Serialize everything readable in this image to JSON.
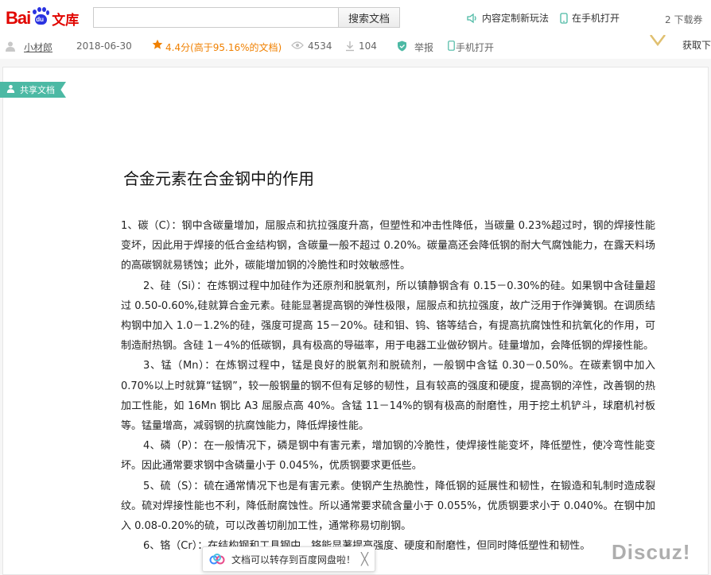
{
  "header": {
    "logo_bai": "Bai",
    "logo_du": "du",
    "logo_wenku": "文库",
    "search_placeholder": "",
    "search_button": "搜索文档",
    "custom_link": "内容定制新玩法",
    "mobile_link": "在手机打开",
    "downloads_text": "2 下载券",
    "get_link": "获取下"
  },
  "meta": {
    "user": "小材郎",
    "date": "2018-06-30",
    "rating": "4.4分(高于95.16%的文档)",
    "views": "4534",
    "downloads": "104",
    "report": "举报",
    "mobile": "手机打开"
  },
  "tag": "共享文档",
  "document": {
    "title": "合金元素在合金钢中的作用",
    "paragraphs": [
      "1、碳（C）：钢中含碳量增加，屈服点和抗拉强度升高，但塑性和冲击性降低，当碳量 0.23%超过时，钢的焊接性能变坏，因此用于焊接的低合金结构钢，含碳量一般不超过 0.20%。碳量高还会降低钢的耐大气腐蚀能力，在露天料场的高碳钢就易锈蚀；此外，碳能增加钢的冷脆性和时效敏感性。",
      "2、硅（Si）：在炼钢过程中加硅作为还原剂和脱氧剂，所以镇静钢含有 0.15－0.30%的硅。如果钢中含硅量超过 0.50-0.60%,硅就算合金元素。硅能显著提高钢的弹性极限，屈服点和抗拉强度，故广泛用于作弹簧钢。在调质结构钢中加入 1.0－1.2%的硅，强度可提高 15－20%。硅和钼、钨、铬等结合，有提高抗腐蚀性和抗氧化的作用，可制造耐热钢。含硅 1－4%的低碳钢，具有极高的导磁率，用于电器工业做矽钢片。硅量增加，会降低钢的焊接性能。",
      "3、锰（Mn）：在炼钢过程中，锰是良好的脱氧剂和脱硫剂，一般钢中含锰 0.30－0.50%。在碳素钢中加入 0.70%以上时就算“锰钢”，较一般钢量的钢不但有足够的韧性，且有较高的强度和硬度，提高钢的淬性，改善钢的热加工性能，如 16Mn 钢比 A3 屈服点高 40%。含锰 11－14%的钢有极高的耐磨性，用于挖土机铲斗，球磨机衬板等。锰量增高，减弱钢的抗腐蚀能力，降低焊接性能。",
      "4、磷（P）：在一般情况下，磷是钢中有害元素，增加钢的冷脆性，使焊接性能变坏，降低塑性，使冷弯性能变坏。因此通常要求钢中含磷量小于 0.045%，优质钢要求更低些。",
      "5、硫（S）：硫在通常情况下也是有害元素。使钢产生热脆性，降低钢的延展性和韧性，在锻造和轧制时造成裂纹。硫对焊接性能也不利，降低耐腐蚀性。所以通常要求硫含量小于 0.055%，优质钢要求小于 0.040%。在钢中加入 0.08-0.20%的硫，可以改善切削加工性，通常称易切削钢。",
      "6、铬（Cr）：在结构钢和工具钢中，铬能显著提高强度、硬度和耐磨性，但同时降低塑性和韧性。"
    ]
  },
  "toast": {
    "text": "文档可以转存到百度网盘啦！",
    "close": "╳"
  },
  "watermark": "Discuz!",
  "colors": {
    "brand_red": "#e10601",
    "brand_blue": "#2932e1",
    "accent_green": "#4cb9a4",
    "rating_orange": "#f08000"
  }
}
